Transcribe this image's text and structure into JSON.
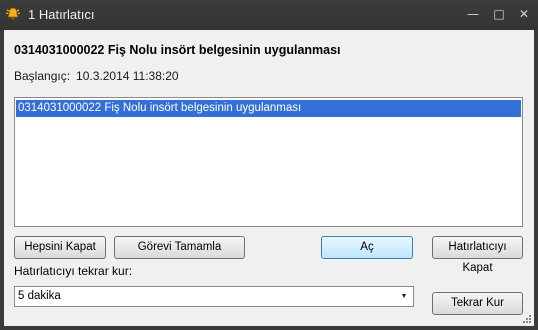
{
  "window": {
    "title": "1 Hatırlatıcı",
    "controls": {
      "minimize": "—",
      "maximize": "□",
      "close": "✕"
    },
    "icon": "alarm-bell-icon"
  },
  "reminder": {
    "heading": "0314031000022 Fiş Nolu insört belgesinin uygulanması",
    "start_label": "Başlangıç:",
    "start_value": "10.3.2014 11:38:20"
  },
  "list": {
    "items": [
      "0314031000022 Fiş Nolu insört belgesinin uygulanması"
    ],
    "selected_index": 0
  },
  "buttons": {
    "dismiss_all": "Hepsini Kapat",
    "complete_task": "Görevi Tamamla",
    "open": "Aç",
    "dismiss_reminder": "Hatırlatıcıyı Kapat",
    "snooze": "Tekrar Kur"
  },
  "snooze": {
    "label": "Hatırlatıcıyı tekrar kur:",
    "selected": "5 dakika"
  },
  "colors": {
    "titlebar": "#3a3a3a",
    "selection": "#3270d8",
    "client_bg": "#f0f0f0"
  }
}
